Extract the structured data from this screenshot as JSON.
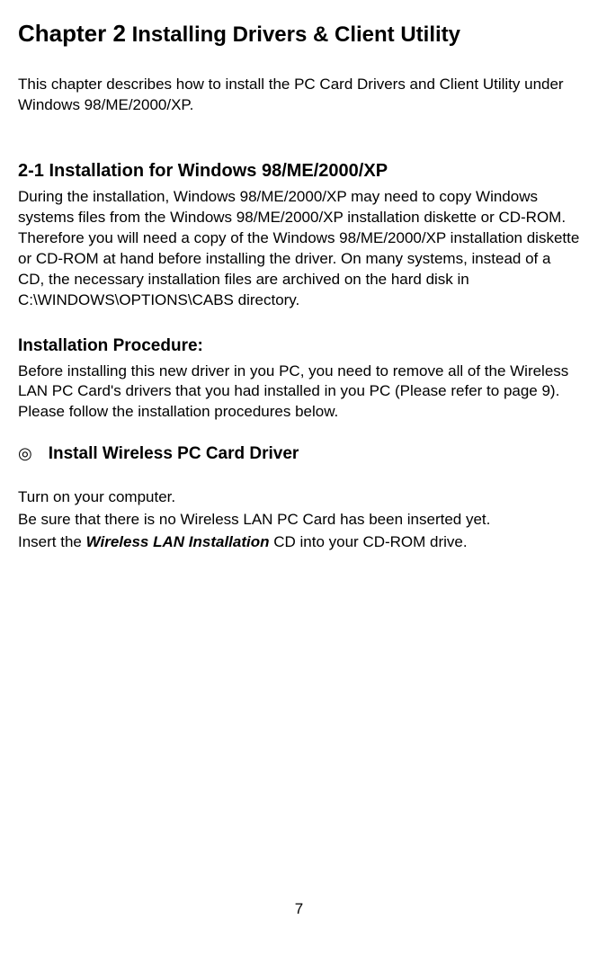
{
  "chapter": {
    "label": "Chapter 2",
    "title": "Installing Drivers & Client Utility",
    "intro": "This chapter describes how to install the PC Card Drivers and Client Utility under Windows 98/ME/2000/XP."
  },
  "section": {
    "heading": "2-1 Installation for Windows 98/ME/2000/XP",
    "body": "During the installation, Windows 98/ME/2000/XP may need to copy Windows systems files from the Windows 98/ME/2000/XP installation diskette or CD-ROM. Therefore you will need a copy of the Windows 98/ME/2000/XP installation diskette or CD-ROM at hand before installing the driver. On many systems, instead of a CD, the necessary installation files are archived on the hard disk in C:\\WINDOWS\\OPTIONS\\CABS directory."
  },
  "procedure": {
    "heading": "Installation Procedure:",
    "body": "Before installing this new driver in you PC, you need to remove all of the Wireless LAN PC Card's drivers that you had installed in you PC (Please refer to page 9). Please follow the installation procedures below."
  },
  "bullet": {
    "symbol": "◎",
    "title": "Install Wireless PC Card Driver"
  },
  "steps": {
    "line1": "Turn on your computer.",
    "line2": "Be sure that there is no Wireless LAN PC Card has been inserted yet.",
    "line3_pre": "Insert the ",
    "line3_bold": "Wireless LAN Installation",
    "line3_post": " CD into your CD-ROM drive."
  },
  "pageNumber": "7"
}
